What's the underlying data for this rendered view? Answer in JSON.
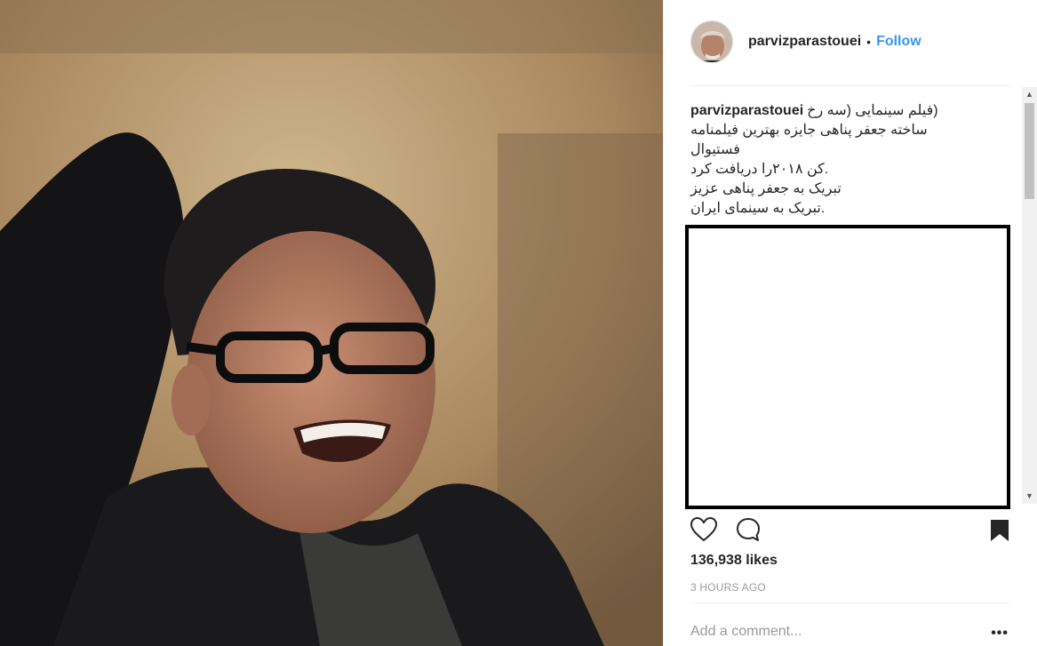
{
  "post": {
    "username": "parvizparastouei",
    "separator": "•",
    "follow_label": "Follow",
    "caption_lines": [
      "(فیلم سینمایی (سه رخ",
      "ساخته جعفر پناهی جایزه بهترین فیلمنامه",
      "فستیوال",
      ".کن ۲۰۱۸را دریافت کرد",
      "تبریک به جعفر پناهی عزیز",
      ".تبریک به سینمای ایران"
    ],
    "likes": "136,938 likes",
    "time": "3 HOURS AGO",
    "comment_placeholder": "Add a comment...",
    "more_label": "•••"
  },
  "icons": {
    "like": "heart-icon",
    "comment": "comment-icon",
    "save": "bookmark-icon",
    "scroll_up": "triangle-up",
    "scroll_down": "triangle-down"
  },
  "colors": {
    "link": "#3897f0",
    "text": "#262626",
    "muted": "#999999"
  }
}
